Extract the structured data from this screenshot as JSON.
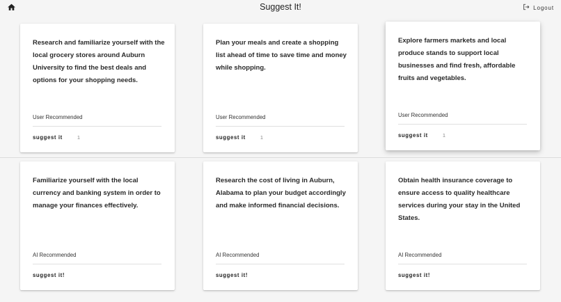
{
  "header": {
    "title": "Suggest It!",
    "home_icon": "home-icon",
    "logout_icon": "logout-icon",
    "logout_label": "Logout"
  },
  "cards": [
    {
      "text": "Research and familiarize yourself with the local grocery stores around Auburn University to find the best deals and options for your shopping needs.",
      "source": "User Recommended",
      "action_label": "suggest it",
      "count": "1"
    },
    {
      "text": "Plan your meals and create a shopping list ahead of time to save time and money while shopping.",
      "source": "User Recommended",
      "action_label": "suggest it",
      "count": "1"
    },
    {
      "text": "Explore farmers markets and local produce stands to support local businesses and find fresh, affordable fruits and vegetables.",
      "source": "User Recommended",
      "action_label": "suggest it",
      "count": "1"
    },
    {
      "text": "Familiarize yourself with the local currency and banking system in order to manage your finances effectively.",
      "source": "AI Recommended",
      "action_label": "suggest it!"
    },
    {
      "text": "Research the cost of living in Auburn, Alabama to plan your budget accordingly and make informed financial decisions.",
      "source": "AI Recommended",
      "action_label": "suggest it!"
    },
    {
      "text": "Obtain health insurance coverage to ensure access to quality healthcare services during your stay in the United States.",
      "source": "AI Recommended",
      "action_label": "suggest it!"
    }
  ]
}
